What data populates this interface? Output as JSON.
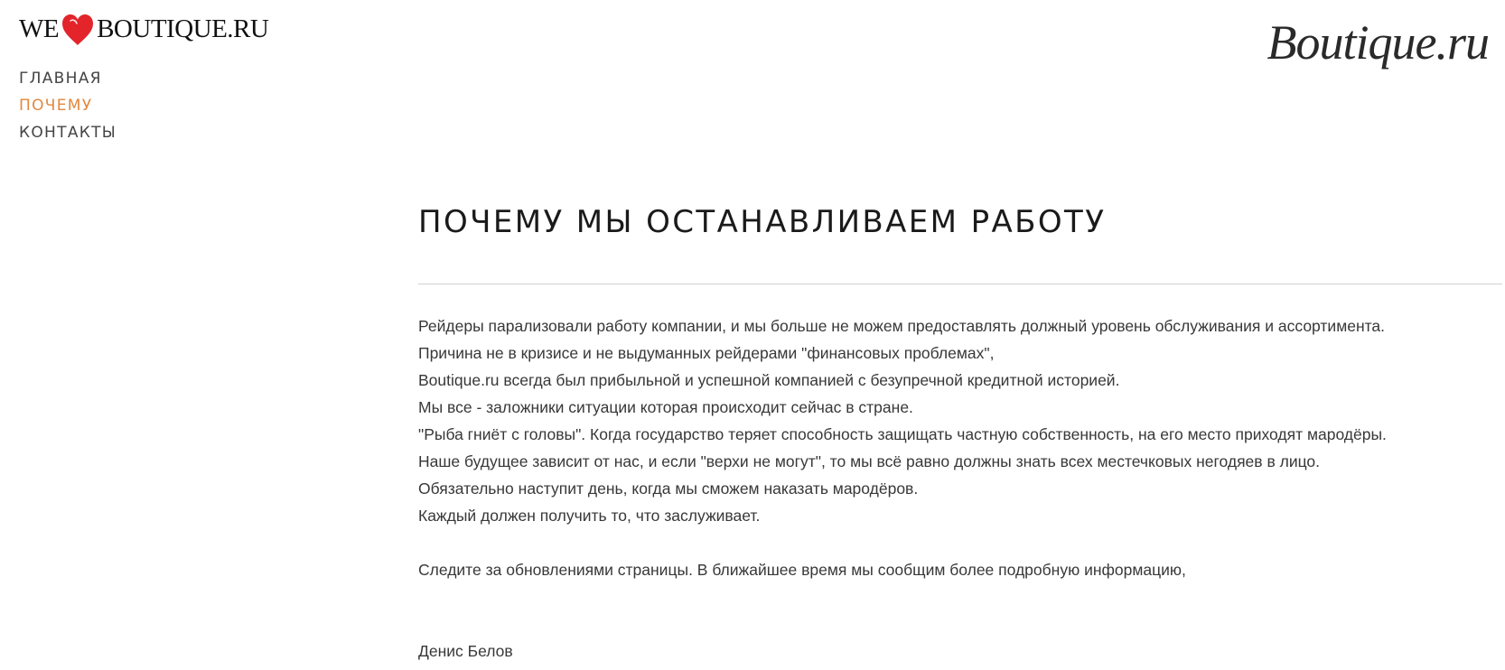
{
  "header": {
    "logo": {
      "text_left": "WE",
      "text_right": "BOUTIQUE.RU",
      "heart_color": "#e3242b"
    },
    "brand_script": "Boutique.ru"
  },
  "nav": {
    "items": [
      {
        "label": "ГЛАВНАЯ",
        "active": false
      },
      {
        "label": "ПОЧЕМУ",
        "active": true
      },
      {
        "label": "КОНТАКТЫ",
        "active": false
      }
    ],
    "active_color": "#e2883e"
  },
  "main": {
    "title": "ПОЧЕМУ МЫ ОСТАНАВЛИВАЕМ РАБОТУ",
    "paragraphs": [
      "Рейдеры парализовали работу компании, и мы больше не можем предоставлять должный уровень обслуживания и ассортимента.",
      "Причина не в кризисе и не выдуманных рейдерами \"финансовых проблемах\",",
      "Boutique.ru всегда был прибыльной и успешной компанией с безупречной кредитной историей.",
      "Мы все - заложники ситуации которая происходит сейчас в стране.",
      "\"Рыба гниёт с головы\". Когда государство теряет способность защищать частную собственность, на его место приходят мародёры.",
      "Наше будущее зависит от нас, и если \"верхи не могут\", то мы всё равно должны знать всех местечковых негодяев в лицо.",
      "Обязательно наступит день, когда мы сможем наказать мародёров.",
      "Каждый должен получить то, что заслуживает."
    ],
    "notice": "Следите за обновлениями страницы. В ближайшее время мы сообщим более подробную информацию,",
    "signature": "Денис Белов"
  }
}
